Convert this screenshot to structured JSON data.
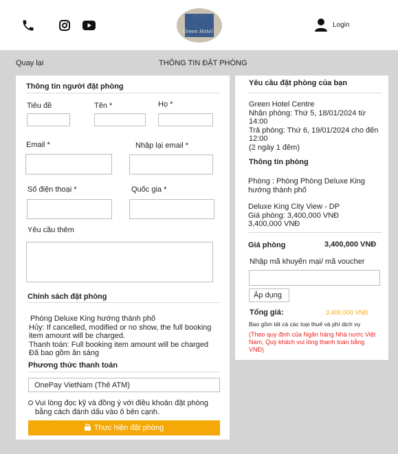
{
  "header": {
    "login_label": "Login",
    "logo_text": "Green Hotel",
    "logo_stars": "★★★★"
  },
  "nav": {
    "back_label": "Quay lại",
    "page_title": "THÔNG TIN ĐẶT PHÒNG"
  },
  "form": {
    "booker_section_title": "Thông tin người đặt phòng",
    "title_label": "Tiêu đề",
    "first_name_label": "Tên *",
    "last_name_label": "Họ *",
    "email_label": "Email *",
    "email_confirm_label": "Nhập lại email *",
    "phone_label": "Số điện thoại *",
    "country_label": "Quốc gia *",
    "requests_label": "Yêu cầu thêm",
    "policy_title": "Chính sách đặt phòng",
    "policy_lines": [
      "Phòng Deluxe King hướng thành phố",
      "Hủy: If cancelled, modified or no show, the full booking",
      "item amount will be charged.",
      "Thanh toán: Full booking item amount will be charged",
      "Đã bao gồm ăn sáng"
    ],
    "payment_title": "Phương thức thanh toán",
    "payment_selected": "OnePay VietNam (Thẻ ATM)",
    "terms_lines": [
      "Vui lòng đọc kỹ và đồng ý với điều khoản đặt phòng",
      "bằng cách đánh dấu vào ô bên cạnh."
    ],
    "submit_label": "Thực hiện đặt phòng"
  },
  "summary": {
    "title": "Yêu cầu đặt phòng của bạn",
    "hotel_name": "Green Hotel Centre",
    "checkin_lines": [
      "Nhận phòng: Thứ 5, 18/01/2024 từ",
      "14:00"
    ],
    "checkout_lines": [
      "Trả phòng: Thứ 6, 19/01/2024 cho đến",
      "12:00"
    ],
    "nights": "(2 ngày 1 đêm)",
    "info_title": "Thông tin phòng",
    "room_lines": [
      "Phòng : Phòng Phòng Deluxe King",
      "hướng thành phố"
    ],
    "rate_lines": [
      "Deluxe King City View - DP",
      "Giá phòng: 3,400,000 VNĐ",
      "3,400,000 VNĐ"
    ],
    "price_label": "Giá phòng",
    "price_value": "3,400,000 VNĐ",
    "voucher_label": "Nhập mã khuyến mại/ mã voucher",
    "apply_label": "Áp dụng",
    "total_label": "Tổng giá:",
    "total_value": "3,400,000 VNĐ",
    "tax_note": "Bao gồm tất cả các loại thuế và phí dịch vụ",
    "bank_note_lines": [
      "(Theo quy định của Ngân hàng Nhà nước Việt",
      "Nam, Quý khách vui lòng thanh toán bằng",
      "VNĐ)"
    ],
    "accent_color": "#f4a908",
    "warning_color": "#e8231f"
  }
}
